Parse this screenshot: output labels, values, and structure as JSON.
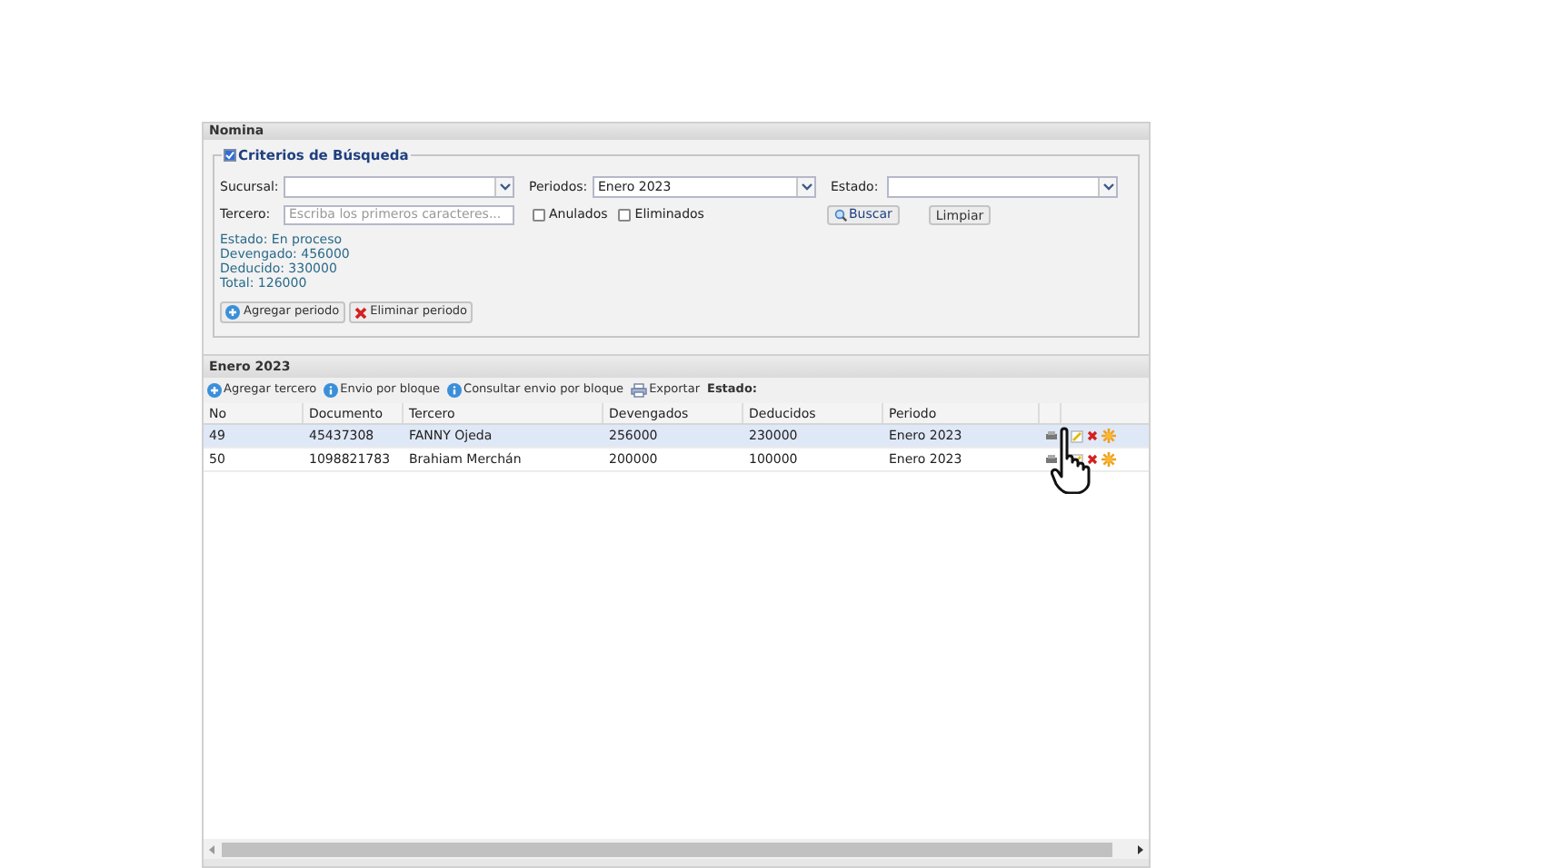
{
  "panel": {
    "title": "Nomina"
  },
  "criteria": {
    "legend": "Criterios de Búsqueda",
    "checked": true,
    "sucursal": {
      "label": "Sucursal:"
    },
    "periodos": {
      "label": "Periodos:",
      "value": "Enero 2023"
    },
    "estado": {
      "label": "Estado:"
    },
    "tercero": {
      "label": "Tercero:",
      "placeholder": "Escriba los primeros caracteres..."
    },
    "checkboxes": [
      {
        "label": "Anulados",
        "checked": false
      },
      {
        "label": "Eliminados",
        "checked": false
      }
    ],
    "search_button": "Buscar",
    "clear_button": "Limpiar",
    "summary": [
      "Estado: En proceso",
      "Devengado: 456000",
      "Deducido: 330000",
      "Total: 126000"
    ],
    "buttons": [
      {
        "kind": "add",
        "label": "Agregar periodo"
      },
      {
        "kind": "delete",
        "label": "Eliminar periodo"
      }
    ]
  },
  "grid": {
    "title": "Enero 2023",
    "toolbar": [
      {
        "kind": "add",
        "label": "Agregar tercero"
      },
      {
        "kind": "info",
        "label": "Envio por bloque"
      },
      {
        "kind": "info",
        "label": "Consultar envio por bloque"
      },
      {
        "kind": "print",
        "label": "Exportar"
      },
      {
        "kind": "label",
        "label": "Estado:"
      }
    ],
    "columns": [
      "No",
      "Documento",
      "Tercero",
      "Devengados",
      "Deducidos",
      "Periodo"
    ],
    "rows": [
      {
        "cells": [
          "49",
          "45437308",
          "FANNY Ojeda",
          "256000",
          "230000",
          "Enero 2023"
        ],
        "selected": true
      },
      {
        "cells": [
          "50",
          "1098821783",
          "Brahiam Merchán",
          "200000",
          "100000",
          "Enero 2023"
        ],
        "selected": false
      }
    ]
  }
}
